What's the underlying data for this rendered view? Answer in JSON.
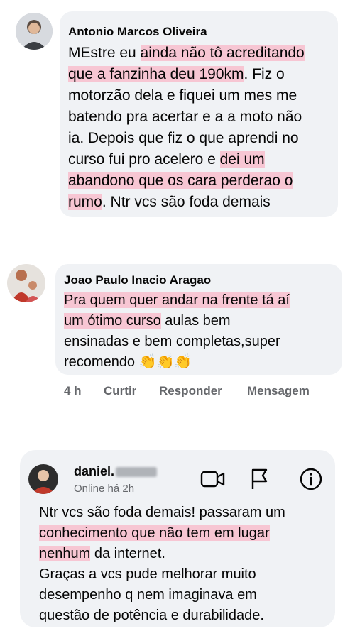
{
  "comments": [
    {
      "author": "Antonio Marcos Oliveira",
      "text_parts": [
        {
          "t": "MEstre eu ",
          "hl": false
        },
        {
          "t": "ainda não tô acreditando",
          "hl": true
        },
        {
          "t": "que a fanzinha deu 190km",
          "hl": true
        },
        {
          "t": ". Fiz o",
          "hl": false
        },
        {
          "t": "motorzão dela e fiquei um mes me",
          "hl": false
        },
        {
          "t": "batendo pra acertar e a a moto não",
          "hl": false
        },
        {
          "t": "ia. Depois que fiz o que aprendi no",
          "hl": false
        },
        {
          "t": "curso fui pro acelero e ",
          "hl": false
        },
        {
          "t": "dei um",
          "hl": true
        },
        {
          "t": "abandono que os cara perderao o",
          "hl": true
        },
        {
          "t": "rumo",
          "hl": true
        },
        {
          "t": ". Ntr vcs são foda demais",
          "hl": false
        }
      ]
    },
    {
      "author": "Joao Paulo Inacio Aragao",
      "text_parts": [
        {
          "t": "Pra quem quer andar na frente tá aí",
          "hl": true
        },
        {
          "t": "um ótimo curso",
          "hl": true
        },
        {
          "t": " aulas bem",
          "hl": false
        },
        {
          "t": "ensinadas e bem completas,super",
          "hl": false
        },
        {
          "t": "recomendo",
          "hl": false
        }
      ],
      "emoji": "👏👏👏",
      "actions": {
        "time": "4 h",
        "like": "Curtir",
        "reply": "Responder",
        "message": "Mensagem"
      }
    }
  ],
  "chat": {
    "name": "daniel.",
    "status": "Online há 2h",
    "icons": [
      "video-call-icon",
      "flag-icon",
      "info-icon"
    ],
    "message_parts": [
      {
        "t": "Ntr vcs são foda demais! passaram um",
        "hl": false
      },
      {
        "t": "conhecimento que não tem em lugar",
        "hl": true
      },
      {
        "t": "nenhum",
        "hl": true
      },
      {
        "t": " da internet.",
        "hl": false
      },
      {
        "t": "Graças a vcs pude melhorar muito",
        "hl": false
      },
      {
        "t": "desempenho q nem imaginava em",
        "hl": false
      },
      {
        "t": "questão de potência e durabilidade.",
        "hl": false
      }
    ]
  },
  "colors": {
    "highlight": "#f7c6d3",
    "bubble": "#f0f2f5",
    "meta": "#65676b"
  }
}
